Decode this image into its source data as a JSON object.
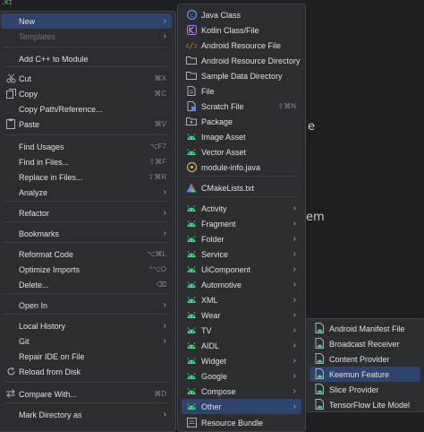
{
  "background": {
    "tab_fragment": ".kt",
    "text_e": "e",
    "text_em": "em"
  },
  "menu_main": [
    {
      "label": "New",
      "arrow": true,
      "selected": true
    },
    {
      "label": "Templates",
      "arrow": true,
      "disabled": true
    },
    {
      "label": "Add C++ to Module"
    },
    {
      "label": "Cut",
      "shortcut": "⌘X",
      "icon": "scissors-icon"
    },
    {
      "label": "Copy",
      "shortcut": "⌘C",
      "icon": "copy-icon"
    },
    {
      "label": "Copy Path/Reference..."
    },
    {
      "label": "Paste",
      "shortcut": "⌘V",
      "icon": "paste-icon"
    },
    {
      "label": "Find Usages",
      "shortcut": "⌥F7"
    },
    {
      "label": "Find in Files...",
      "shortcut": "⇧⌘F"
    },
    {
      "label": "Replace in Files...",
      "shortcut": "⇧⌘R"
    },
    {
      "label": "Analyze",
      "arrow": true
    },
    {
      "label": "Refactor",
      "arrow": true
    },
    {
      "label": "Bookmarks",
      "arrow": true
    },
    {
      "label": "Reformat Code",
      "shortcut": "⌥⌘L"
    },
    {
      "label": "Optimize Imports",
      "shortcut": "^⌥O"
    },
    {
      "label": "Delete...",
      "shortcut": "⌫"
    },
    {
      "label": "Open In",
      "arrow": true
    },
    {
      "label": "Local History",
      "arrow": true
    },
    {
      "label": "Git",
      "arrow": true
    },
    {
      "label": "Repair IDE on File"
    },
    {
      "label": "Reload from Disk",
      "icon": "reload-icon"
    },
    {
      "label": "Compare With...",
      "shortcut": "⌘D",
      "icon": "compare-icon"
    },
    {
      "label": "Mark Directory as",
      "arrow": true
    }
  ],
  "menu_new": [
    {
      "label": "Java Class",
      "icon": "java-class-icon"
    },
    {
      "label": "Kotlin Class/File",
      "icon": "kotlin-icon"
    },
    {
      "label": "Android Resource File",
      "icon": "android-resource-file-icon"
    },
    {
      "label": "Android Resource Directory",
      "icon": "folder-icon"
    },
    {
      "label": "Sample Data Directory",
      "icon": "folder-icon"
    },
    {
      "label": "File",
      "icon": "file-icon"
    },
    {
      "label": "Scratch File",
      "shortcut": "⇧⌘N",
      "icon": "scratch-file-icon"
    },
    {
      "label": "Package",
      "icon": "package-icon"
    },
    {
      "label": "Image Asset",
      "icon": "image-asset-icon"
    },
    {
      "label": "Vector Asset",
      "icon": "vector-asset-icon"
    },
    {
      "label": "module-info.java",
      "icon": "module-info-icon"
    },
    {
      "label": "CMakeLists.txt",
      "icon": "cmake-icon"
    },
    {
      "label": "Activity",
      "arrow": true,
      "icon": "android-icon"
    },
    {
      "label": "Fragment",
      "arrow": true,
      "icon": "android-icon"
    },
    {
      "label": "Folder",
      "arrow": true,
      "icon": "android-icon"
    },
    {
      "label": "Service",
      "arrow": true,
      "icon": "android-icon"
    },
    {
      "label": "UiComponent",
      "arrow": true,
      "icon": "android-icon"
    },
    {
      "label": "Automotive",
      "arrow": true,
      "icon": "android-icon"
    },
    {
      "label": "XML",
      "arrow": true,
      "icon": "android-icon"
    },
    {
      "label": "Wear",
      "arrow": true,
      "icon": "android-icon"
    },
    {
      "label": "TV",
      "arrow": true,
      "icon": "android-icon"
    },
    {
      "label": "AIDL",
      "arrow": true,
      "icon": "android-icon"
    },
    {
      "label": "Widget",
      "arrow": true,
      "icon": "android-icon"
    },
    {
      "label": "Google",
      "arrow": true,
      "icon": "android-icon"
    },
    {
      "label": "Compose",
      "arrow": true,
      "icon": "android-icon"
    },
    {
      "label": "Other",
      "arrow": true,
      "selected": true,
      "icon": "android-icon"
    },
    {
      "label": "Resource Bundle",
      "icon": "resource-bundle-icon"
    }
  ],
  "menu_other": [
    {
      "label": "Android Manifest File",
      "icon": "android-file-icon"
    },
    {
      "label": "Broadcast Receiver",
      "icon": "android-file-icon"
    },
    {
      "label": "Content Provider",
      "icon": "android-file-icon"
    },
    {
      "label": "Keemun Feature",
      "selected": true,
      "icon": "android-file-icon"
    },
    {
      "label": "Slice Provider",
      "icon": "android-file-icon"
    },
    {
      "label": "TensorFlow Lite Model",
      "icon": "android-file-icon"
    }
  ],
  "colors": {
    "menu_bg": "#2b2d30",
    "selected": "#2e436e",
    "text": "#dfe1e5",
    "shortcut": "#868991",
    "android_green": "#3ddc84"
  }
}
